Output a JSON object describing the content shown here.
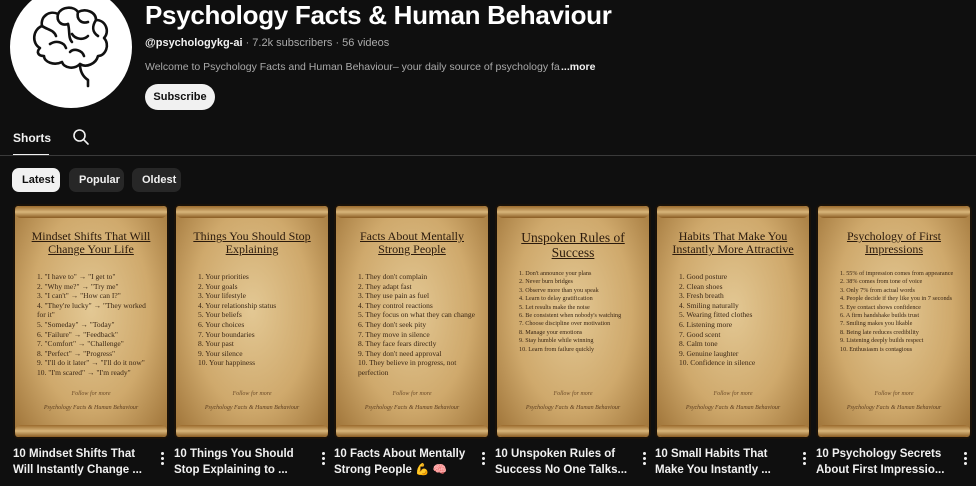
{
  "channel": {
    "name": "Psychology Facts & Human Behaviour",
    "handle": "@psychologykg-ai",
    "meta": " · 7.2k subscribers · 56 videos",
    "description": "Welcome to Psychology Facts and Human Behaviour– your daily source of psychology fa",
    "more_label": "...more",
    "subscribe_label": "Subscribe",
    "avatar_icon": "brain-icon"
  },
  "tabs": [
    {
      "label": "Shorts",
      "active": true
    }
  ],
  "search_icon": "search-icon",
  "chips": [
    {
      "label": "Latest",
      "active": true
    },
    {
      "label": "Popular",
      "active": false
    },
    {
      "label": "Oldest",
      "active": false
    }
  ],
  "colors": {
    "background": "#0f0f0f",
    "text_primary": "#f1f1f1",
    "text_secondary": "#aaaaaa",
    "chip_inactive": "#272727",
    "parchment": "#d8b67e"
  },
  "shorts": [
    {
      "title": "10 Mindset Shifts That Will Instantly Change ...",
      "scroll_title": "Mindset Shifts That Will Change Your Life",
      "items": [
        "1. \"I have to\" → \"I get to\"",
        "2. \"Why me?\" → \"Try me\"",
        "3. \"I can't\" → \"How can I?\"",
        "4. \"They're lucky\" → \"They worked for it\"",
        "5. \"Someday\" → \"Today\"",
        "6. \"Failure\" → \"Feedback\"",
        "7. \"Comfort\" → \"Challenge\"",
        "8. \"Perfect\" → \"Progress\"",
        "9. \"I'll do it later\" → \"I'll do it now\"",
        "10. \"I'm scared\" → \"I'm ready\""
      ],
      "footer": "Follow for more",
      "signature": "Psychology Facts & Human Behaviour"
    },
    {
      "title": "10 Things You Should Stop Explaining to ...",
      "scroll_title": "Things You Should Stop Explaining",
      "items": [
        "1. Your priorities",
        "2. Your goals",
        "3. Your lifestyle",
        "4. Your relationship status",
        "5. Your beliefs",
        "6. Your choices",
        "7. Your boundaries",
        "8. Your past",
        "9. Your silence",
        "10. Your happiness"
      ],
      "footer": "Follow for more",
      "signature": "Psychology Facts & Human Behaviour"
    },
    {
      "title": "10 Facts About Mentally Strong People 💪 🧠",
      "scroll_title": "Facts About Mentally Strong People",
      "items": [
        "1. They don't complain",
        "2. They adapt fast",
        "3. They use pain as fuel",
        "4. They control reactions",
        "5. They focus on what they can change",
        "6. They don't seek pity",
        "7. They move in silence",
        "8. They face fears directly",
        "9. They don't need approval",
        "10. They believe in progress, not perfection"
      ],
      "footer": "Follow for more",
      "signature": "Psychology Facts & Human Behaviour"
    },
    {
      "title": "10 Unspoken Rules of Success No One Talks...",
      "scroll_title": "Unspoken Rules of Success",
      "items": [
        "1. Don't announce your plans",
        "2. Never burn bridges",
        "3. Observe more than you speak",
        "4. Learn to delay gratification",
        "5. Let results make the noise",
        "6. Be consistent when nobody's watching",
        "7. Choose discipline over motivation",
        "8. Manage your emotions",
        "9. Stay humble while winning",
        "10. Learn from failure quickly"
      ],
      "footer": "Follow for more",
      "signature": "Psychology Facts & Human Behaviour"
    },
    {
      "title": "10 Small Habits That Make You Instantly ...",
      "scroll_title": "Habits That Make You Instantly More Attractive",
      "items": [
        "1. Good posture",
        "2. Clean shoes",
        "3. Fresh breath",
        "4. Smiling naturally",
        "5. Wearing fitted clothes",
        "6. Listening more",
        "7. Good scent",
        "8. Calm tone",
        "9. Genuine laughter",
        "10. Confidence in silence"
      ],
      "footer": "Follow for more",
      "signature": "Psychology Facts & Human Behaviour"
    },
    {
      "title": "10 Psychology Secrets About First Impressio...",
      "scroll_title": "Psychology of First Impressions",
      "items": [
        "1. 55% of impression comes from appearance",
        "2. 38% comes from tone of voice",
        "3. Only 7% from actual words",
        "4. People decide if they like you in 7 seconds",
        "5. Eye contact shows confidence",
        "6. A firm handshake builds trust",
        "7. Smiling makes you likable",
        "8. Being late reduces credibility",
        "9. Listening deeply builds respect",
        "10. Enthusiasm is contagious"
      ],
      "footer": "Follow for more",
      "signature": "Psychology Facts & Human Behaviour"
    }
  ]
}
